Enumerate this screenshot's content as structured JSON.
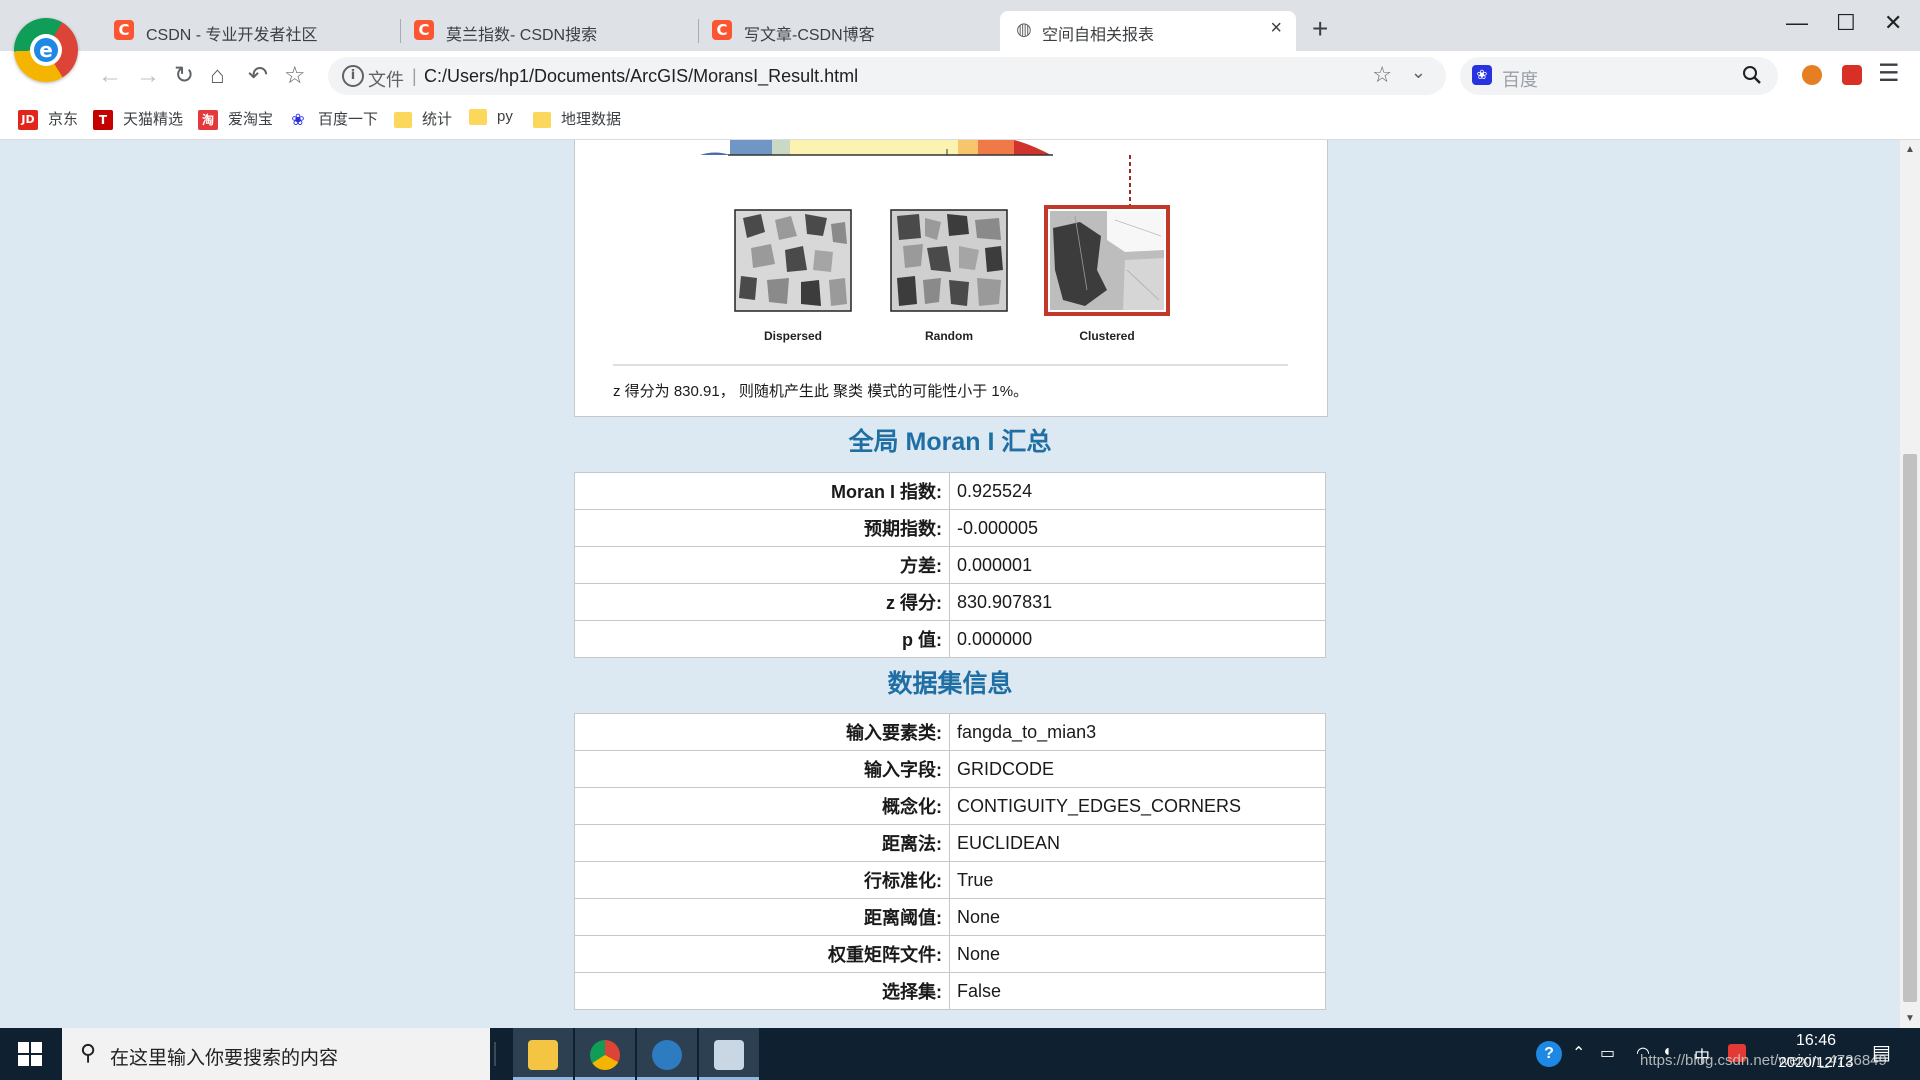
{
  "browser": {
    "tabs": [
      {
        "title": "CSDN - 专业开发者社区",
        "icon_glyph": "C",
        "active": false
      },
      {
        "title": "莫兰指数- CSDN搜索",
        "icon_glyph": "C",
        "active": false
      },
      {
        "title": "写文章-CSDN博客",
        "icon_glyph": "C",
        "active": false
      },
      {
        "title": "空间自相关报表",
        "icon_glyph": "",
        "active": true
      }
    ],
    "url_scheme": "文件",
    "url": "C:/Users/hp1/Documents/ArcGIS/MoransI_Result.html",
    "search_placeholder": "百度",
    "bookmarks": [
      {
        "label": "京东",
        "icon": "JD"
      },
      {
        "label": "天猫精选",
        "icon": "T"
      },
      {
        "label": "爱淘宝",
        "icon": "淘"
      },
      {
        "label": "百度一下",
        "icon": "paw"
      },
      {
        "label": "统计",
        "icon": "folder"
      },
      {
        "label": "py",
        "icon": "folder"
      },
      {
        "label": "地理数据",
        "icon": "folder"
      }
    ]
  },
  "report": {
    "patterns": {
      "dispersed": "Dispersed",
      "random": "Random",
      "clustered": "Clustered"
    },
    "conclusion": "z 得分为 830.91， 则随机产生此 聚类 模式的可能性小于 1%。",
    "summary_title": "全局 Moran I 汇总",
    "summary": [
      {
        "key": "Moran I 指数:",
        "value": "0.925524"
      },
      {
        "key": "预期指数:",
        "value": "-0.000005"
      },
      {
        "key": "方差:",
        "value": "0.000001"
      },
      {
        "key": "z 得分:",
        "value": "830.907831"
      },
      {
        "key": "p 值:",
        "value": "0.000000"
      }
    ],
    "dataset_title": "数据集信息",
    "dataset": [
      {
        "key": "输入要素类:",
        "value": "fangda_to_mian3"
      },
      {
        "key": "输入字段:",
        "value": "GRIDCODE"
      },
      {
        "key": "概念化:",
        "value": "CONTIGUITY_EDGES_CORNERS"
      },
      {
        "key": "距离法:",
        "value": "EUCLIDEAN"
      },
      {
        "key": "行标准化:",
        "value": "True"
      },
      {
        "key": "距离阈值:",
        "value": "None"
      },
      {
        "key": "权重矩阵文件:",
        "value": "None"
      },
      {
        "key": "选择集:",
        "value": "False"
      }
    ]
  },
  "taskbar": {
    "search_placeholder": "在这里输入你要搜索的内容",
    "time": "16:46",
    "date": "2020/12/13",
    "ime": "中",
    "watermark": "https://blog.csdn.net/weixin_4726849"
  },
  "colors": {
    "heading": "#1f6fa4",
    "page_bg": "#dce9f2",
    "clustered_border": "#c0392b"
  }
}
